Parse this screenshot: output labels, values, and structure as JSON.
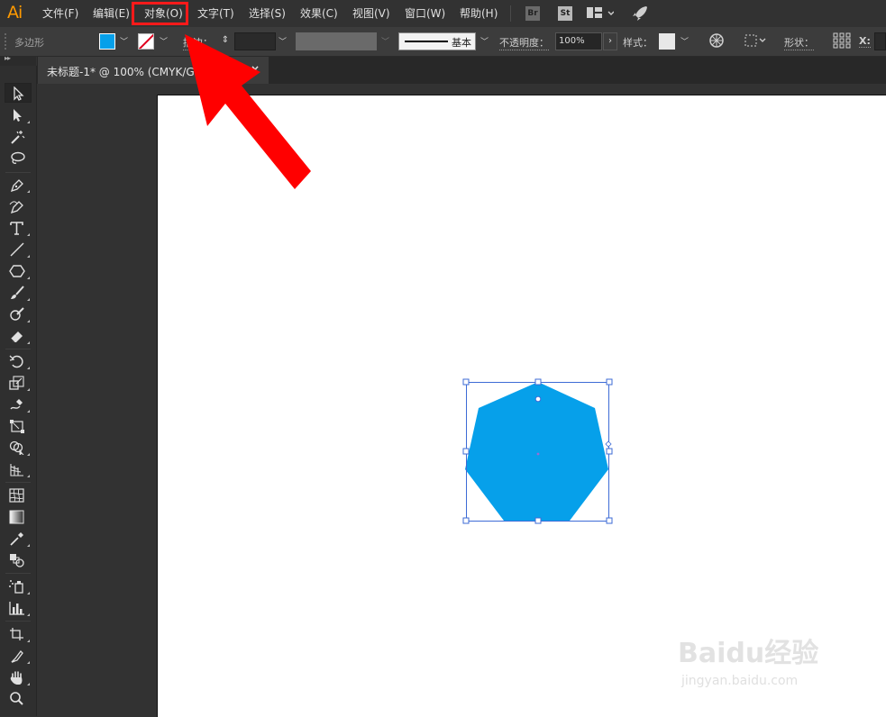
{
  "app": {
    "logo": "Ai"
  },
  "menu": {
    "items": [
      "文件(F)",
      "编辑(E)",
      "对象(O)",
      "文字(T)",
      "选择(S)",
      "效果(C)",
      "视图(V)",
      "窗口(W)",
      "帮助(H)"
    ],
    "highlighted": "对象(O)",
    "app_buttons": [
      "Br",
      "St"
    ]
  },
  "control_bar": {
    "object_type": "多边形",
    "fill_color": "#06a0ea",
    "stroke_label": "描边：",
    "stroke_style_label": "基本",
    "opacity_label": "不透明度：",
    "opacity_value": "100%",
    "style_label": "样式：",
    "shape_label": "形状：",
    "x_label": "X:"
  },
  "document": {
    "tab_title": "未标题-1* @ 100% (CMYK/GPU 预览)",
    "close_symbol": "×"
  },
  "selection": {
    "shape": "heptagon",
    "fill_color": "#06a0ea",
    "bbox_color": "#3d6bd6"
  },
  "annotation": {
    "arrow_color": "#ff0000"
  },
  "watermark": {
    "main": "Baidu经验",
    "sub": "jingyan.baidu.com"
  },
  "tools": [
    "selection-tool",
    "direct-selection-tool",
    "magic-wand-tool",
    "lasso-tool",
    "pen-tool",
    "curvature-tool",
    "type-tool",
    "line-segment-tool",
    "polygon-tool",
    "paintbrush-tool",
    "blob-brush-tool",
    "eraser-tool",
    "rotate-tool",
    "scale-tool",
    "warp-tool",
    "free-transform-tool",
    "shape-builder-tool",
    "perspective-grid-tool",
    "mesh-tool",
    "gradient-tool",
    "eyedropper-tool",
    "blend-tool",
    "symbol-sprayer-tool",
    "column-graph-tool",
    "artboard-tool",
    "slice-tool",
    "hand-tool",
    "zoom-tool"
  ]
}
